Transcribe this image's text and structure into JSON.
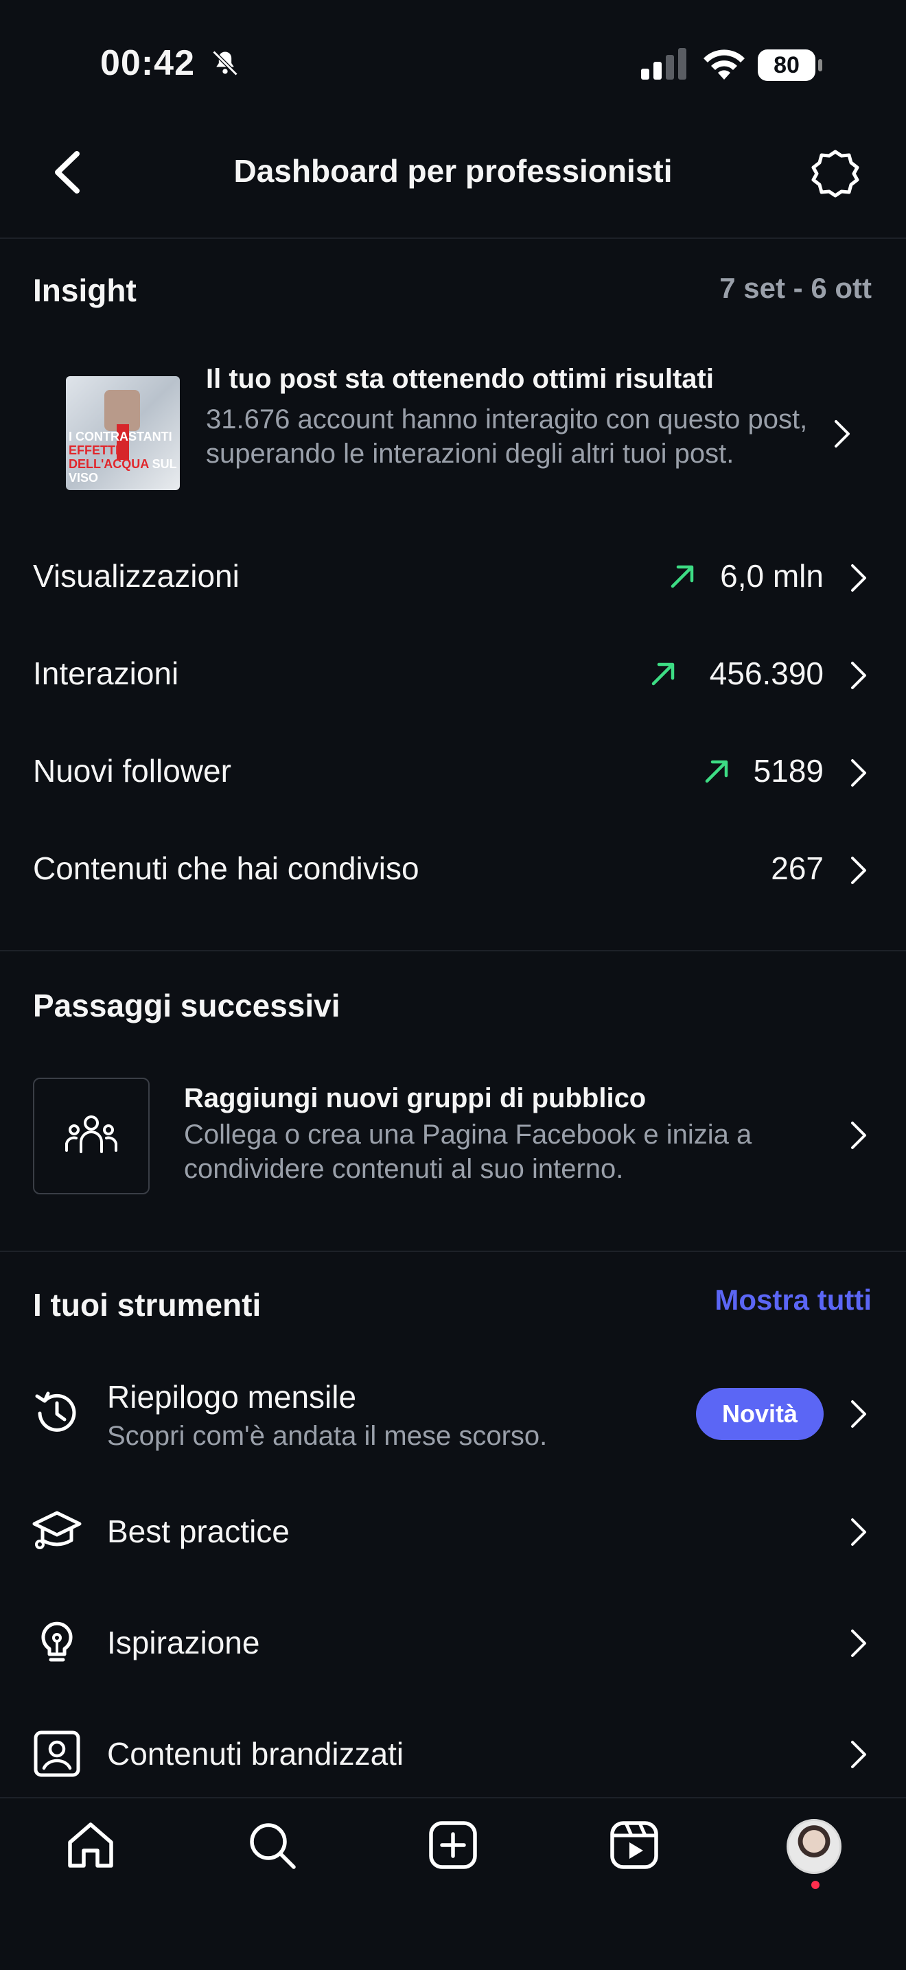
{
  "status_bar": {
    "time": "00:42",
    "battery": "80"
  },
  "header": {
    "title": "Dashboard per professionisti"
  },
  "insight": {
    "title": "Insight",
    "date_range": "7 set - 6 ott",
    "post_card": {
      "thumb_text_1": "I CONTRASTANTI",
      "thumb_text_1b": "EFFETTI",
      "thumb_text_2a": "DELL'ACQUA",
      "thumb_text_2b": "SUL VISO",
      "title": "Il tuo post sta ottenendo ottimi risultati",
      "body": "31.676 account hanno interagito con questo post, superando le interazioni degli altri tuoi post."
    },
    "rows": [
      {
        "label": "Visualizzazioni",
        "value": "6,0 mln",
        "trend": "up"
      },
      {
        "label": "Interazioni",
        "value": "456.390",
        "trend": "up"
      },
      {
        "label": "Nuovi follower",
        "value": "5189",
        "trend": "up"
      },
      {
        "label": "Contenuti che hai condiviso",
        "value": "267",
        "trend": "none"
      }
    ]
  },
  "next_steps": {
    "title": "Passaggi successivi",
    "item": {
      "title": "Raggiungi nuovi gruppi di pubblico",
      "body": "Collega o crea una Pagina Facebook e inizia a condividere contenuti al suo interno."
    }
  },
  "tools": {
    "title": "I tuoi strumenti",
    "show_all": "Mostra tutti",
    "items": [
      {
        "label": "Riepilogo mensile",
        "sub": "Scopri com'è andata il mese scorso.",
        "badge": "Novità",
        "icon": "history-icon"
      },
      {
        "label": "Best practice",
        "icon": "graduation-cap-icon"
      },
      {
        "label": "Ispirazione",
        "icon": "lightbulb-icon"
      },
      {
        "label": "Contenuti brandizzati",
        "icon": "branded-content-icon"
      }
    ]
  },
  "bottom_nav": [
    "home-icon",
    "search-icon",
    "create-icon",
    "reels-icon",
    "profile-avatar"
  ],
  "colors": {
    "accent": "#5b66f5",
    "trend_up": "#3ddc84",
    "background": "#0c0f14",
    "muted": "#9aa0aa"
  }
}
